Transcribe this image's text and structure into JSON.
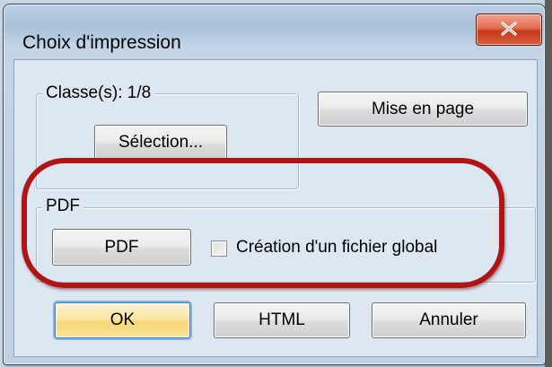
{
  "window": {
    "title": "Choix d'impression",
    "close_glyph": "X"
  },
  "classes_group": {
    "caption": "Classe(s): 1/8",
    "selection_button": "Sélection..."
  },
  "layout_button": "Mise en page",
  "pdf_group": {
    "caption": "PDF",
    "pdf_button": "PDF",
    "global_file_checkbox": {
      "label": "Création d'un fichier global",
      "checked": false
    }
  },
  "footer": {
    "ok_button": "OK",
    "html_button": "HTML",
    "cancel_button": "Annuler"
  },
  "annotation": {
    "highlight_color": "#b01515"
  }
}
